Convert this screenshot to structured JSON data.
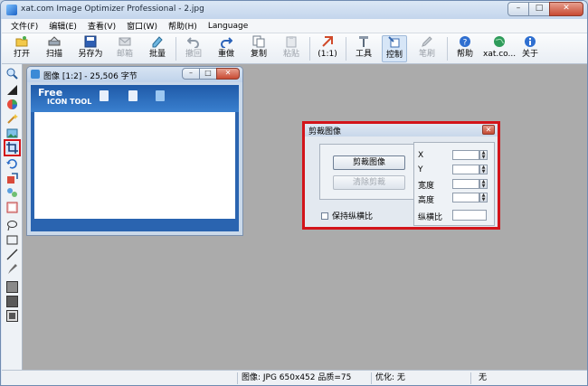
{
  "window": {
    "title": "xat.com  Image Optimizer Professional - 2.jpg"
  },
  "menus": [
    "文件(F)",
    "编辑(E)",
    "查看(V)",
    "窗口(W)",
    "帮助(H)",
    "Language"
  ],
  "toolbar": {
    "open": "打开",
    "scan": "扫描",
    "save_as": "另存为",
    "mail": "邮箱",
    "batch": "批量",
    "undo": "撤回",
    "redo": "重做",
    "copy": "复制",
    "paste": "粘贴",
    "zoom": "(1:1)",
    "tools": "工具",
    "control": "控制",
    "brush": "笔刷",
    "help": "帮助",
    "site": "xat.co...",
    "about": "关于"
  },
  "image_window": {
    "title": "图像 [1:2] - 25,506 字节",
    "logo_free": "Free",
    "logo_tool": "ICON TOOL"
  },
  "crop_dialog": {
    "title": "剪裁图像",
    "crop_button": "剪裁图像",
    "clear_button": "清除剪裁",
    "keep_ratio_label": "保持纵横比",
    "x_label": "X",
    "y_label": "Y",
    "width_label": "宽度",
    "height_label": "高度",
    "ratio_label": "纵横比"
  },
  "status": {
    "image_info": "图像: JPG 650x452  品质=75",
    "optimize": "优化: 无",
    "last": "无"
  },
  "colors": {
    "highlight": "#d3141a",
    "workspace": "#ababab"
  }
}
